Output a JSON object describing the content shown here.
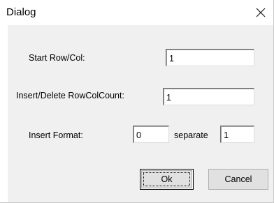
{
  "window": {
    "title": "Dialog",
    "close_glyph": "✕"
  },
  "form": {
    "start_label": "Start Row/Col:",
    "start_value": "1",
    "count_label": "Insert/Delete RowColCount:",
    "count_value": "1",
    "format_label": "Insert Format:",
    "format_value": "0",
    "separate_label": "separate",
    "separate_value": "1"
  },
  "buttons": {
    "ok_label": "Ok",
    "cancel_label": "Cancel"
  }
}
